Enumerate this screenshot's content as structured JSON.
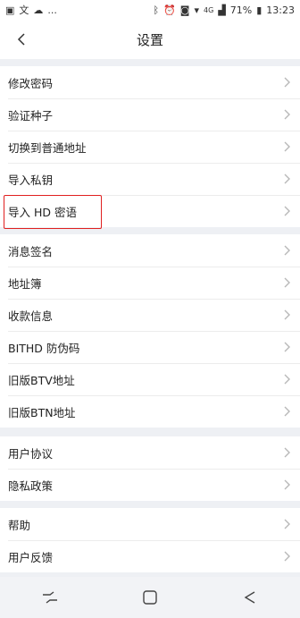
{
  "status_bar": {
    "left_text": "...",
    "signal_label": "4G",
    "battery": "71%",
    "time": "13:23"
  },
  "header": {
    "title": "设置"
  },
  "sections": [
    {
      "items": [
        "修改密码",
        "验证种子",
        "切换到普通地址",
        "导入私钥",
        "导入 HD 密语"
      ]
    },
    {
      "items": [
        "消息签名",
        "地址簿",
        "收款信息",
        "BITHD 防伪码",
        "旧版BTV地址",
        "旧版BTN地址"
      ]
    },
    {
      "items": [
        "用户协议",
        "隐私政策"
      ]
    },
    {
      "items": [
        "帮助",
        "用户反馈"
      ]
    }
  ],
  "highlight": {
    "target": "导入 HD 密语",
    "color": "#e02020"
  },
  "colors": {
    "background": "#eef0f4",
    "chevron": "#b8b8b8",
    "text": "#222222"
  },
  "icons": {
    "status_left": [
      "image-icon",
      "translate-icon",
      "cloud-icon"
    ],
    "status_right": [
      "bluetooth-icon",
      "alarm-icon",
      "nfc-icon",
      "wifi-icon",
      "signal-icon",
      "battery-icon"
    ],
    "nav": [
      "recent-apps-icon",
      "home-icon",
      "back-icon"
    ]
  }
}
